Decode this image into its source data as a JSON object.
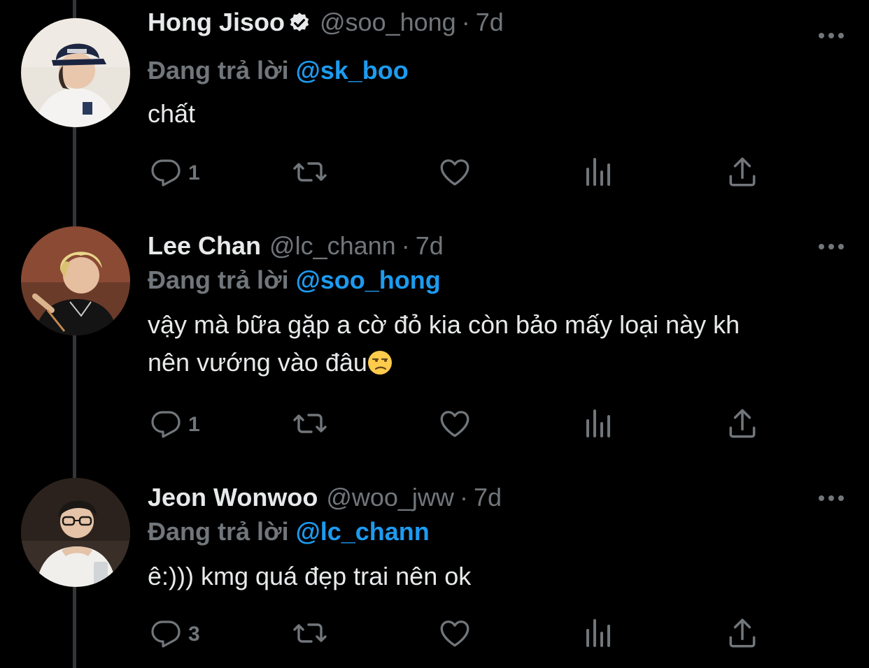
{
  "reply_label": "Đang trả lời",
  "tweets": [
    {
      "name": "Hong Jisoo",
      "verified": true,
      "handle": "@soo_hong",
      "dot": "·",
      "time": "7d",
      "reply_to": "@sk_boo",
      "text": "chất",
      "replies": "1"
    },
    {
      "name": "Lee Chan",
      "verified": false,
      "handle": "@lc_chann",
      "dot": "·",
      "time": "7d",
      "reply_to": "@soo_hong",
      "text_line1": "vậy mà bữa gặp a cờ đỏ kia còn bảo mấy loại này kh",
      "text_line2": "nên vướng vào đâu",
      "emoji": "unamused-face",
      "replies": "1"
    },
    {
      "name": "Jeon Wonwoo",
      "verified": false,
      "handle": "@woo_jww",
      "dot": "·",
      "time": "7d",
      "reply_to": "@lc_chann",
      "text": "ê:))) kmg quá đẹp trai nên ok",
      "replies": "3"
    }
  ],
  "colors": {
    "background": "#000000",
    "text": "#e7e9ea",
    "secondary": "#71767b",
    "accent": "#1d9bf0",
    "thread_line": "#333639"
  },
  "icons": [
    "reply-icon",
    "retweet-icon",
    "like-icon",
    "views-icon",
    "share-icon",
    "more-icon",
    "verified-icon"
  ]
}
